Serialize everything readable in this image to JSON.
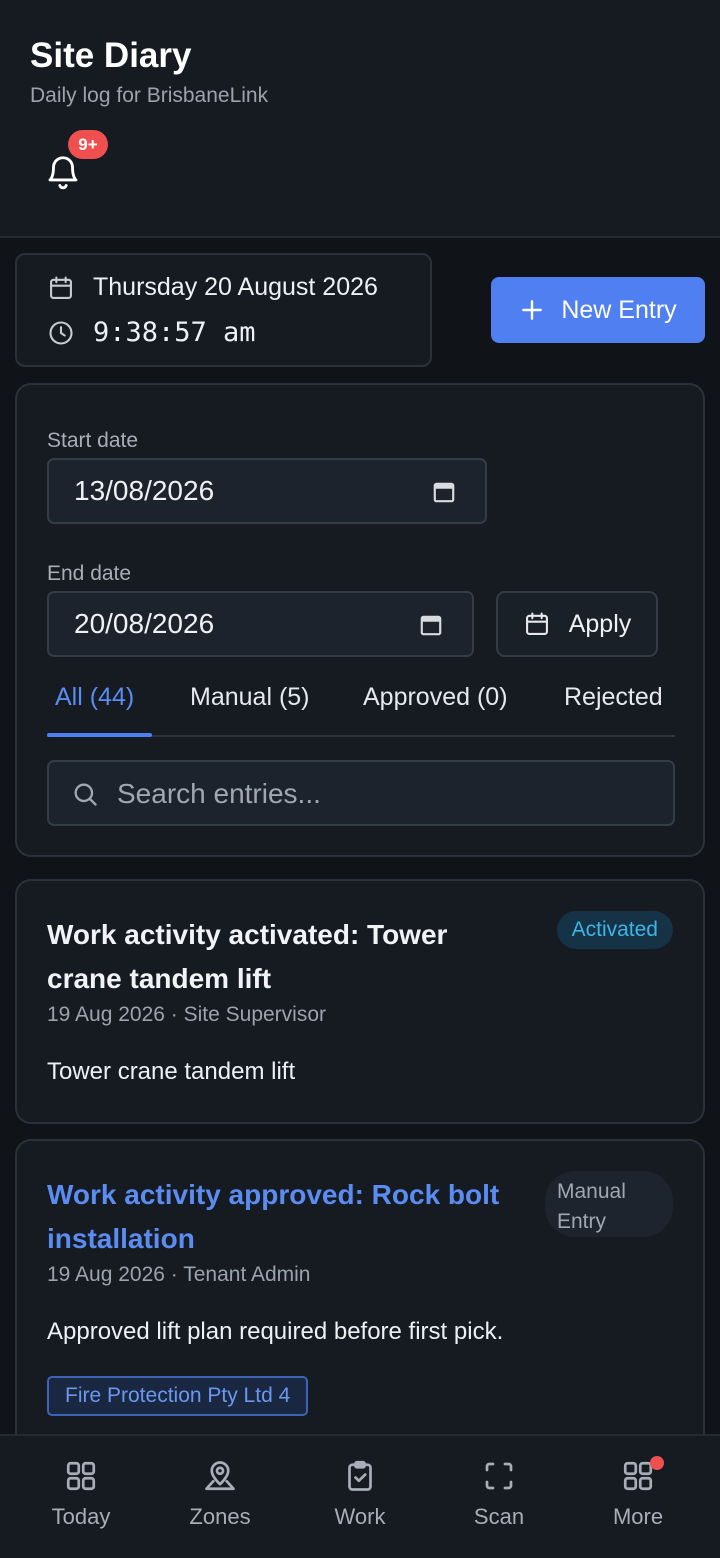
{
  "header": {
    "title": "Site Diary",
    "subtitle": "Daily log for BrisbaneLink",
    "notifications_badge": "9+"
  },
  "datetime": {
    "date": "Thursday 20 August 2026",
    "time": "9:38:57 am"
  },
  "actions": {
    "new_entry_label": "New Entry"
  },
  "filters": {
    "start_date_label": "Start date",
    "start_date_value": "13/08/2026",
    "end_date_label": "End date",
    "end_date_value": "20/08/2026",
    "apply_label": "Apply",
    "tabs": [
      {
        "label": "All (44)",
        "active": true
      },
      {
        "label": "Manual (5)",
        "active": false
      },
      {
        "label": "Approved (0)",
        "active": false
      },
      {
        "label": "Rejected",
        "active": false
      }
    ],
    "search_placeholder": "Search entries..."
  },
  "entries": [
    {
      "title": "Work activity activated: Tower crane tandem lift",
      "meta": "19 Aug 2026 · Site Supervisor",
      "body": "Tower crane tandem lift",
      "status": "Activated"
    },
    {
      "title": "Work activity approved: Rock bolt installation",
      "meta": "19 Aug 2026 · Tenant Admin",
      "body": "Approved lift plan required before first pick.",
      "status": "Manual Entry",
      "tag": "Fire Protection Pty Ltd 4"
    }
  ],
  "bottom_nav": [
    {
      "label": "Today",
      "icon": "grid-icon"
    },
    {
      "label": "Zones",
      "icon": "map-pin-icon"
    },
    {
      "label": "Work",
      "icon": "clipboard-check-icon"
    },
    {
      "label": "Scan",
      "icon": "scan-icon"
    },
    {
      "label": "More",
      "icon": "apps-icon",
      "has_dot": true
    }
  ],
  "colors": {
    "background": "#101418",
    "surface": "#161b22",
    "accent": "#4f7ff0",
    "link": "#5b8cf2",
    "danger": "#ef4f4f",
    "activated": "#3db5e6"
  }
}
